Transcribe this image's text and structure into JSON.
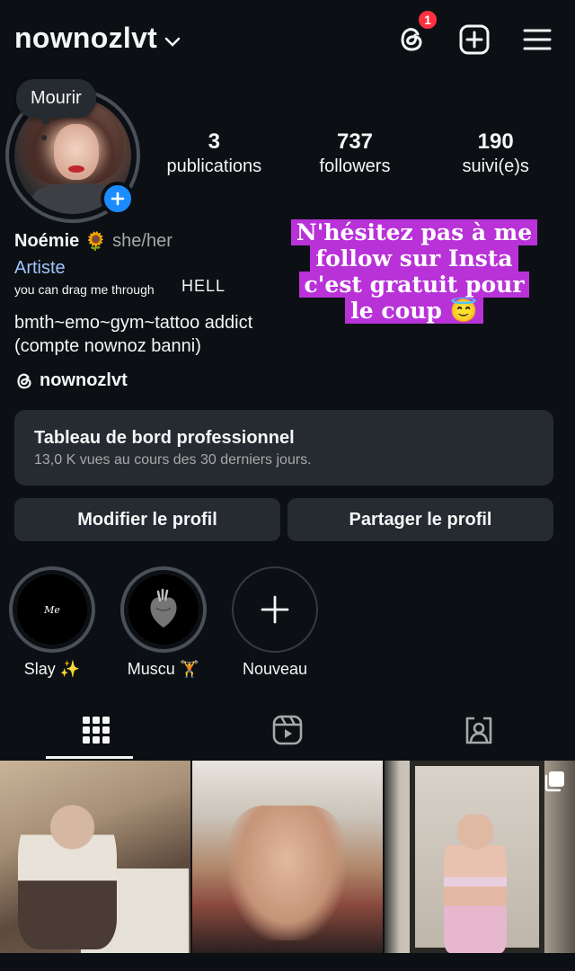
{
  "header": {
    "username": "nownozlvt",
    "threads_badge": "1"
  },
  "profile": {
    "note": "Mourir",
    "stats": [
      {
        "value": "3",
        "label": "publications"
      },
      {
        "value": "737",
        "label": "followers"
      },
      {
        "value": "190",
        "label": "suivi(e)s"
      }
    ],
    "name": "Noémie",
    "name_emoji": "🌻",
    "pronouns": "she/her",
    "category": "Artiste",
    "bio_line1": "you can drag me through",
    "bio_hell": "HELL",
    "bio_line2": "bmth~emo~gym~tattoo addict",
    "bio_line3": "(compte nownoz banni)",
    "threads_handle": "nownozlvt"
  },
  "story_overlay": {
    "lines": [
      "N'hésitez pas à me",
      "follow sur Insta",
      "c'est gratuit pour",
      "le coup 😇"
    ]
  },
  "dashboard": {
    "title": "Tableau de bord professionnel",
    "subtitle": "13,0 K vues au cours des 30 derniers jours."
  },
  "actions": {
    "edit": "Modifier le profil",
    "share": "Partager le profil"
  },
  "highlights": [
    {
      "label": "Slay ✨",
      "cover": "Me"
    },
    {
      "label": "Muscu 🏋️",
      "cover": ""
    },
    {
      "label": "Nouveau",
      "cover": ""
    }
  ],
  "tabs": [
    {
      "icon": "grid-icon"
    },
    {
      "icon": "reels-icon"
    },
    {
      "icon": "tagged-icon"
    }
  ],
  "colors": {
    "background": "#0c1014",
    "button": "#262b31",
    "accent_blue": "#1a8cff",
    "story_highlight": "#b832d8",
    "badge": "#ff3040"
  }
}
